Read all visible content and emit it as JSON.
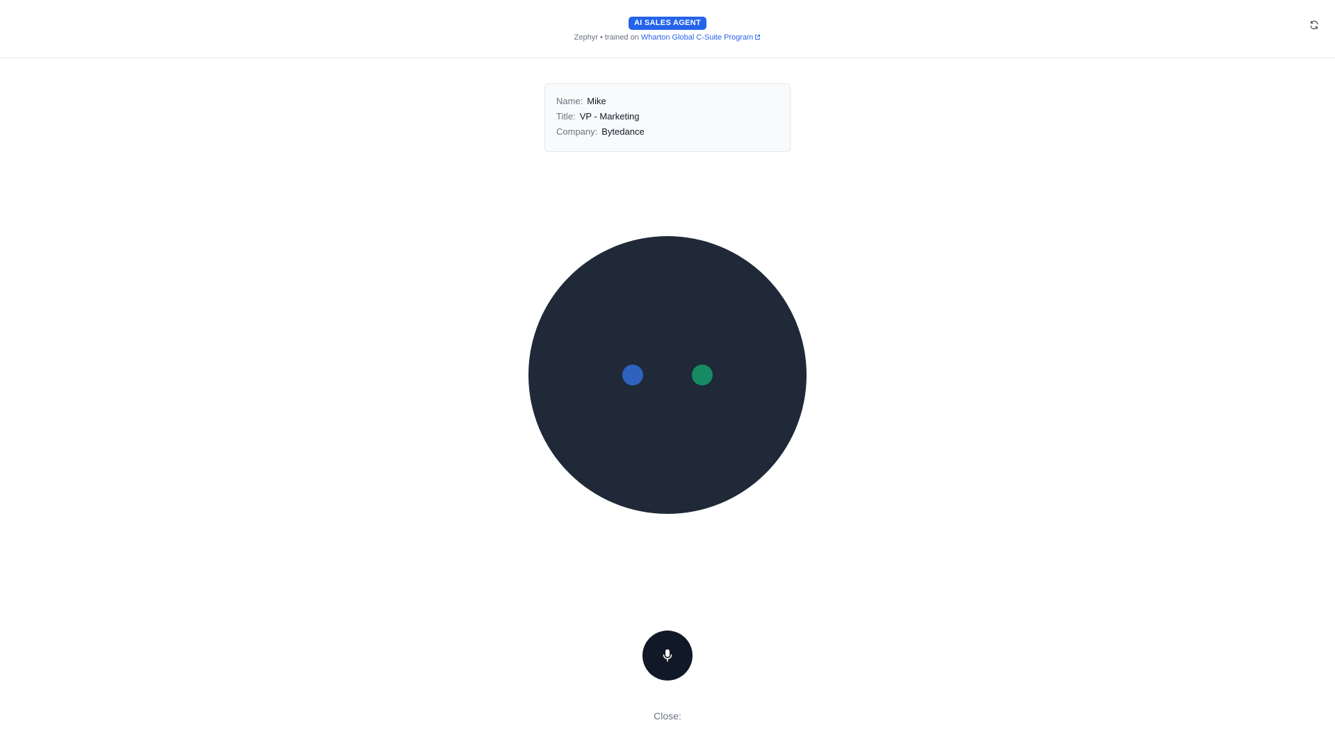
{
  "header": {
    "badge": "AI SALES AGENT",
    "agent_name": "Zephyr",
    "separator": "•",
    "trained_on_text": "trained on",
    "program_link": "Wharton Global C-Suite Program",
    "refresh_icon": "refresh-icon",
    "external_link_icon": "external-link-icon"
  },
  "contact": {
    "name_label": "Name:",
    "name_value": "Mike",
    "title_label": "Title:",
    "title_value": "VP - Marketing",
    "company_label": "Company:",
    "company_value": "Bytedance"
  },
  "orb": {
    "background": "#1f2937",
    "dot_left_color": "#2f62bf",
    "dot_right_color": "#168a63"
  },
  "controls": {
    "mic_icon": "microphone-icon",
    "close_label": "Close:"
  },
  "colors": {
    "accent": "#2563eb",
    "muted": "#6b7280"
  }
}
